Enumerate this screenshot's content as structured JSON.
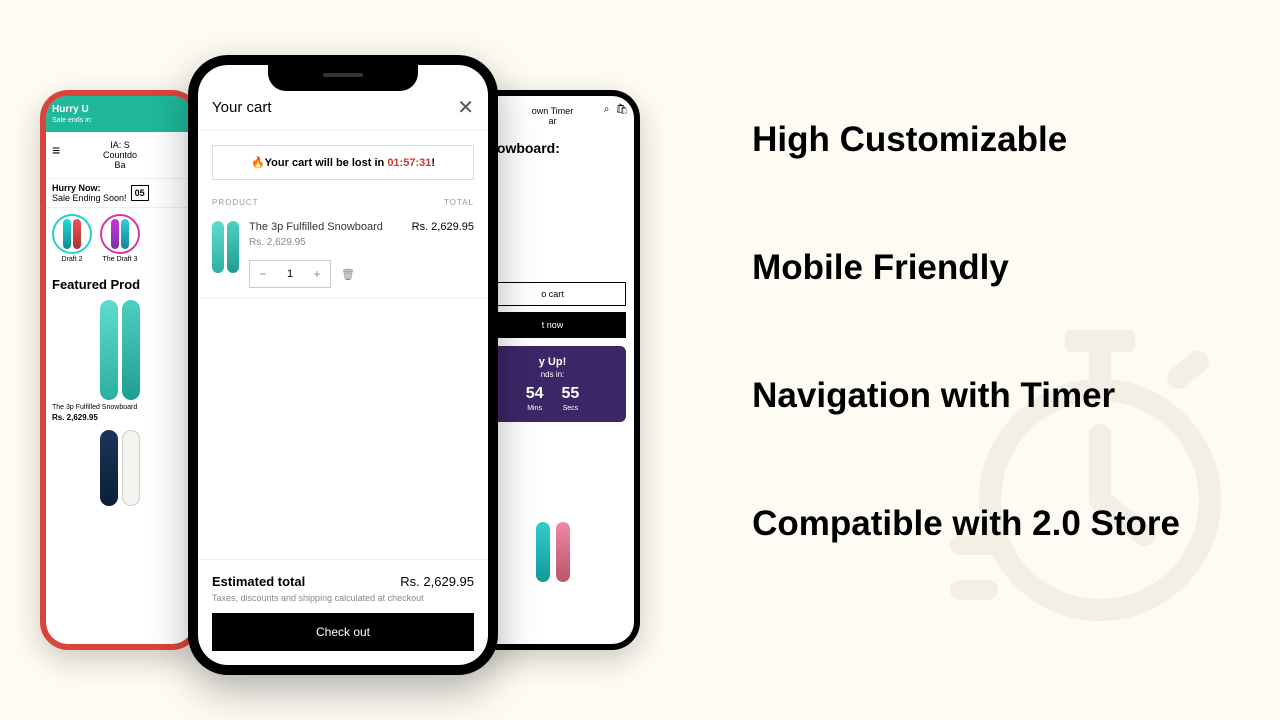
{
  "features": {
    "f1": "High Customizable",
    "f2": "Mobile Friendly",
    "f3": "Navigation with Timer",
    "f4": "Compatible with 2.0 Store"
  },
  "phone1": {
    "banner_title": "Hurry U",
    "banner_sub": "Sale ends in:",
    "header_line1": "IA: S",
    "header_line2": "Countdo",
    "header_line3": "Ba",
    "hurry_title": "Hurry Now:",
    "hurry_sub": "Sale Ending Soon!",
    "hurry_num": "05",
    "draft1": "Draft 2",
    "draft2": "The Draft 3",
    "featured": "Featured Prod",
    "product_name": "The 3p Fulfilled Snowboard",
    "price": "Rs. 2,629.95"
  },
  "phone3": {
    "header_line1": "own Timer",
    "header_line2": "ar",
    "title": "Snowboard:",
    "add_cart": "o cart",
    "buy_now": "t now",
    "timer_title": "y Up!",
    "timer_sub": "nds in:",
    "mins_val": "54",
    "mins_lbl": "Mins",
    "secs_val": "55",
    "secs_lbl": "Secs"
  },
  "phone2": {
    "title": "Your cart",
    "warning_prefix": "🔥Your cart will be lost in ",
    "warning_time": "01:57:31",
    "col_product": "PRODUCT",
    "col_total": "TOTAL",
    "product_name": "The 3p Fulfilled Snowboard",
    "product_price": "Rs. 2,629.95",
    "qty": "1",
    "line_total": "Rs. 2,629.95",
    "est_label": "Estimated total",
    "est_value": "Rs. 2,629.95",
    "taxes": "Taxes, discounts and shipping calculated at checkout",
    "checkout": "Check out"
  }
}
